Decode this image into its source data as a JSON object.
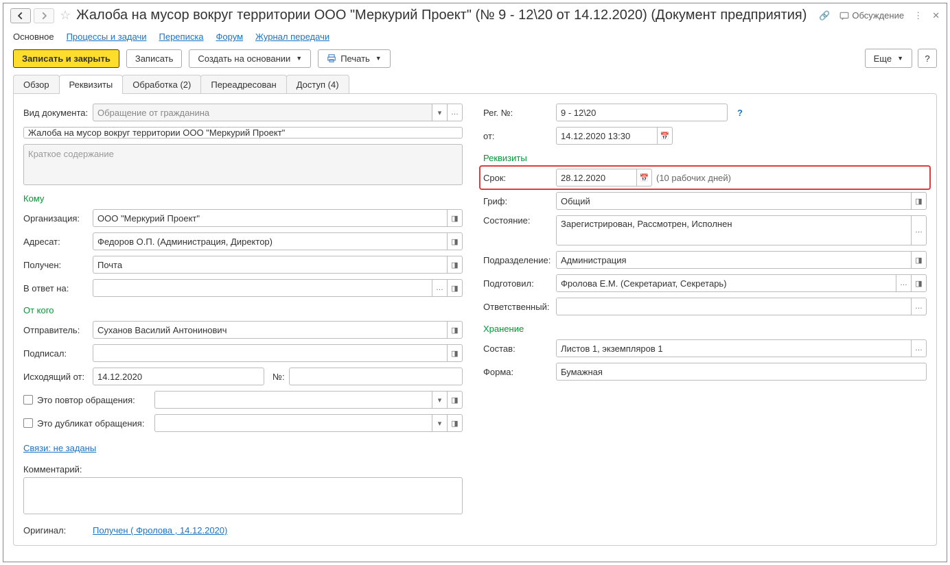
{
  "title": "Жалоба на мусор вокруг территории ООО \"Меркурий Проект\" (№ 9 - 12\\20 от 14.12.2020) (Документ предприятия)",
  "discuss_label": "Обсуждение",
  "main_tabs": {
    "main": "Основное",
    "processes": "Процессы и задачи",
    "correspondence": "Переписка",
    "forum": "Форум",
    "journal": "Журнал передачи"
  },
  "toolbar": {
    "save_close": "Записать и закрыть",
    "save": "Записать",
    "create_based": "Создать на основании",
    "print": "Печать",
    "more": "Еще",
    "help": "?"
  },
  "sub_tabs": {
    "overview": "Обзор",
    "requisites": "Реквизиты",
    "processing": "Обработка (2)",
    "forwarded": "Переадресован",
    "access": "Доступ (4)"
  },
  "left": {
    "doc_type_label": "Вид документа:",
    "doc_type_value": "Обращение от гражданина",
    "subject": "Жалоба на мусор вокруг территории ООО \"Меркурий Проект\"",
    "summary_placeholder": "Краткое содержание",
    "to_section": "Кому",
    "org_label": "Организация:",
    "org_value": "ООО \"Меркурий Проект\"",
    "addressee_label": "Адресат:",
    "addressee_value": "Федоров О.П. (Администрация, Директор)",
    "received_label": "Получен:",
    "received_value": "Почта",
    "reply_to_label": "В ответ на:",
    "from_section": "От кого",
    "sender_label": "Отправитель:",
    "sender_value": "Суханов Василий Антонинович",
    "signed_label": "Подписал:",
    "outgoing_date_label": "Исходящий от:",
    "outgoing_date_value": "14.12.2020",
    "outgoing_no_label": "№:",
    "repeat_label": "Это повтор обращения:",
    "duplicate_label": "Это дубликат обращения:",
    "links_label": "Связи: не заданы",
    "comment_label": "Комментарий:",
    "original_label": "Оригинал:",
    "original_value": "Получен ( Фролова , 14.12.2020)"
  },
  "right": {
    "reg_no_label": "Рег. №:",
    "reg_no_value": "9 - 12\\20",
    "from_date_label": "от:",
    "from_date_value": "14.12.2020 13:30",
    "req_section": "Реквизиты",
    "deadline_label": "Срок:",
    "deadline_value": "28.12.2020",
    "deadline_note": "(10 рабочих дней)",
    "grif_label": "Гриф:",
    "grif_value": "Общий",
    "state_label": "Состояние:",
    "state_value": "Зарегистрирован, Рассмотрен, Исполнен",
    "dept_label": "Подразделение:",
    "dept_value": "Администрация",
    "prepared_label": "Подготовил:",
    "prepared_value": "Фролова Е.М. (Секретариат, Секретарь)",
    "responsible_label": "Ответственный:",
    "storage_section": "Хранение",
    "composition_label": "Состав:",
    "composition_value": "Листов 1, экземпляров 1",
    "form_label": "Форма:",
    "form_value": "Бумажная"
  }
}
